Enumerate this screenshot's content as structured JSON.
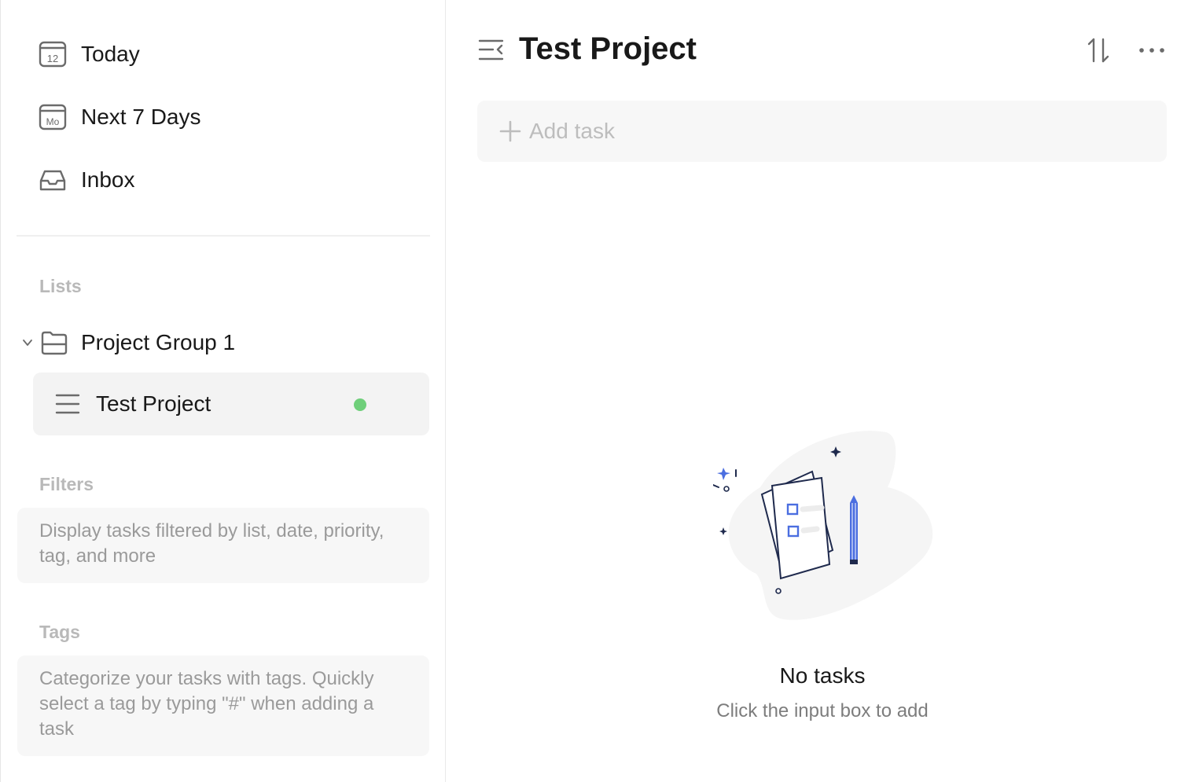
{
  "sidebar": {
    "nav": [
      {
        "label": "Today",
        "icon": "calendar-today-icon",
        "icon_text": "12"
      },
      {
        "label": "Next 7 Days",
        "icon": "calendar-week-icon",
        "icon_text": "Mo"
      },
      {
        "label": "Inbox",
        "icon": "inbox-icon"
      }
    ],
    "lists_title": "Lists",
    "group": {
      "label": "Project Group 1",
      "expanded": true
    },
    "project": {
      "label": "Test Project",
      "color": "#6fcf7a",
      "selected": true
    },
    "filters_title": "Filters",
    "filters_hint": "Display tasks filtered by list, date, priority, tag, and more",
    "tags_title": "Tags",
    "tags_hint": "Categorize your tasks with tags. Quickly select a tag by typing \"#\" when adding a task"
  },
  "main": {
    "title": "Test Project",
    "add_task_placeholder": "Add task",
    "empty_title": "No tasks",
    "empty_subtitle": "Click the input box to add"
  },
  "colors": {
    "accent": "#4b6ee0",
    "dot_green": "#6fcf7a",
    "icon_gray": "#6b6b6b"
  }
}
